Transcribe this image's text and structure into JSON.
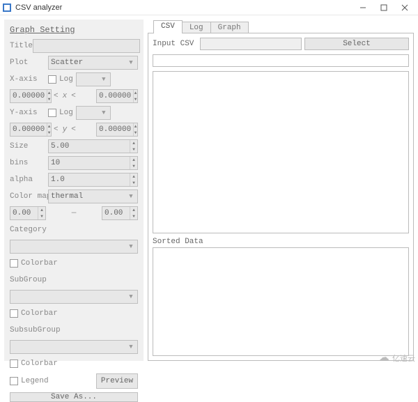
{
  "window": {
    "title": "CSV analyzer"
  },
  "sidebar": {
    "heading": "Graph Setting",
    "title_label": "Title",
    "title_value": "",
    "plot_label": "Plot",
    "plot_value": "Scatter",
    "xaxis_label": "X-axis",
    "yaxis_label": "Y-axis",
    "log_label": "Log",
    "range_x_left": "0.00000",
    "range_x_op1": "<",
    "range_x_mid": "x",
    "range_x_op2": "<",
    "range_x_right": "0.00000",
    "range_y_left": "0.00000",
    "range_y_op1": "<",
    "range_y_mid": "y",
    "range_y_op2": "<",
    "range_y_right": "0.00000",
    "size_label": "Size",
    "size_value": "5.00",
    "bins_label": "bins",
    "bins_value": "10",
    "alpha_label": "alpha",
    "alpha_value": "1.0",
    "colormap_label": "Color map",
    "colormap_value": "thermal",
    "cmap_min": "0.00",
    "cmap_dash": "—",
    "cmap_max": "0.00",
    "category_label": "Category",
    "colorbar_label": "Colorbar",
    "subgroup_label": "SubGroup",
    "subsubgroup_label": "SubsubGroup",
    "legend_label": "Legend",
    "preview_label": "Preview",
    "save_label": "Save As..."
  },
  "tabs": {
    "csv": "CSV",
    "log": "Log",
    "graph": "Graph"
  },
  "main": {
    "input_csv_label": "Input CSV",
    "select_label": "Select",
    "sorted_label": "Sorted Data"
  },
  "watermark": "亿速云"
}
